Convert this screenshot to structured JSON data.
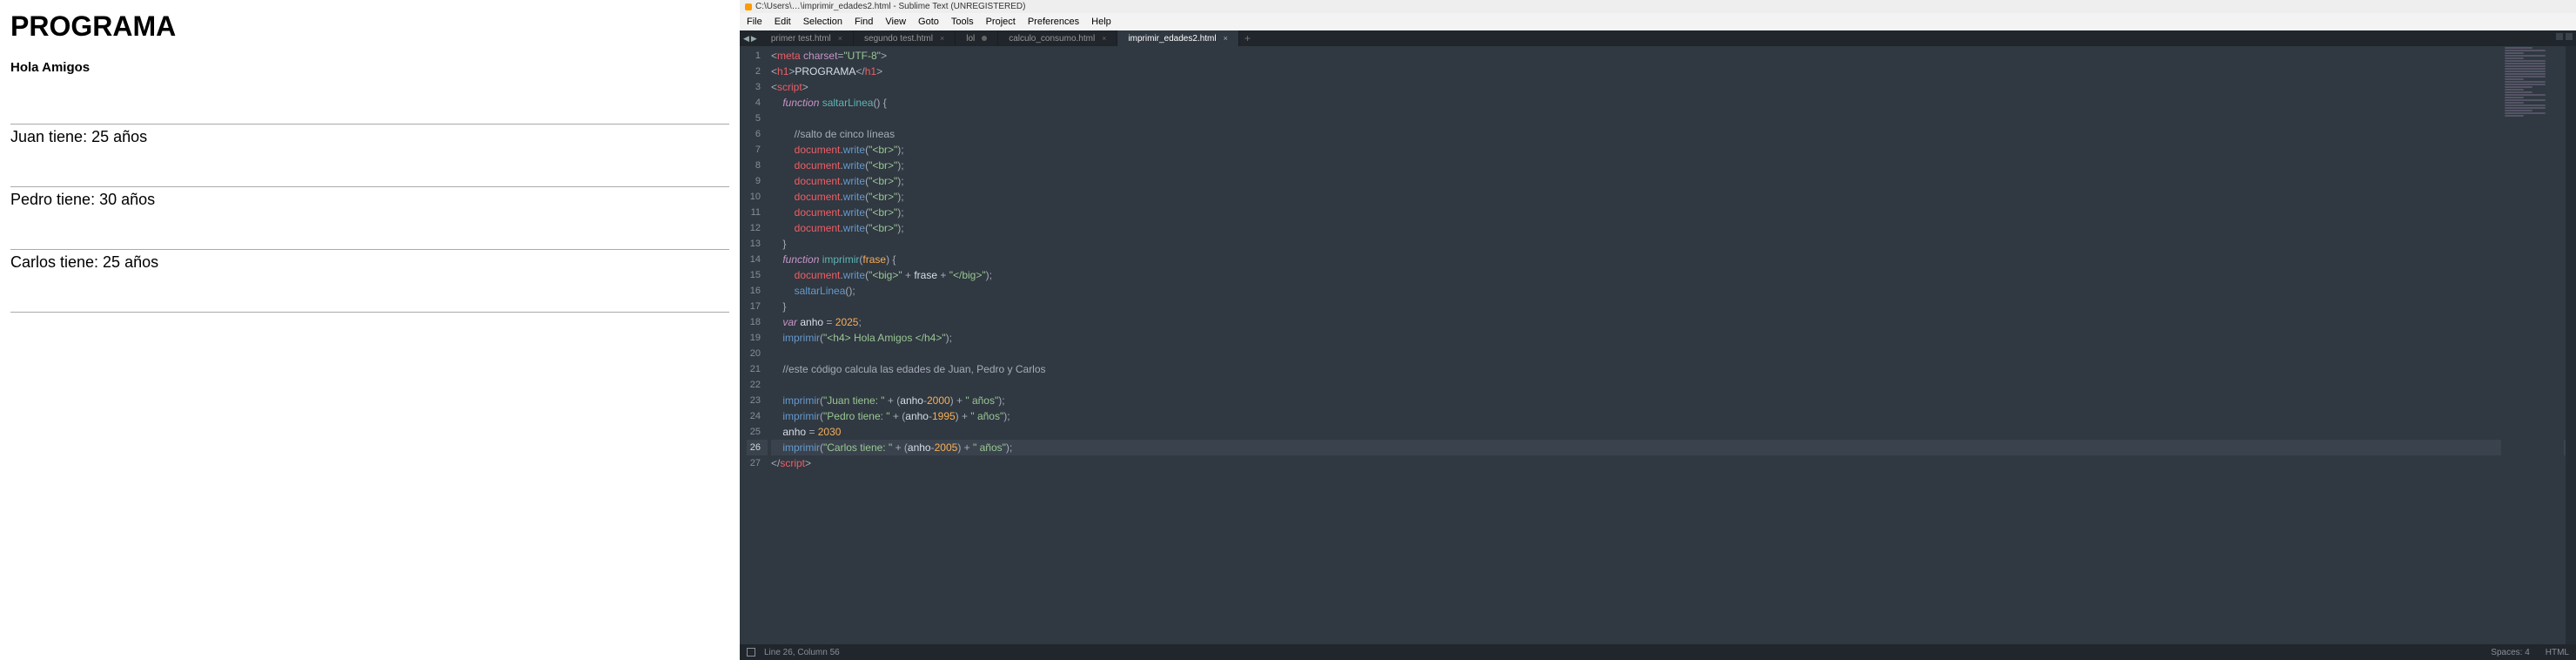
{
  "browser": {
    "title": "PROGRAMA",
    "subtitle": "Hola Amigos",
    "lines": [
      "Juan tiene: 25 años",
      "Pedro tiene: 30 años",
      "Carlos tiene: 25 años"
    ]
  },
  "editor": {
    "window_title": "C:\\Users\\…\\imprimir_edades2.html - Sublime Text (UNREGISTERED)",
    "menu": [
      "File",
      "Edit",
      "Selection",
      "Find",
      "View",
      "Goto",
      "Tools",
      "Project",
      "Preferences",
      "Help"
    ],
    "tabs": [
      {
        "label": "primer test.html",
        "active": false,
        "dirty": false
      },
      {
        "label": "segundo test.html",
        "active": false,
        "dirty": false
      },
      {
        "label": "lol",
        "active": false,
        "dirty": true
      },
      {
        "label": "calculo_consumo.html",
        "active": false,
        "dirty": false
      },
      {
        "label": "imprimir_edades2.html",
        "active": true,
        "dirty": false
      }
    ],
    "status": {
      "cursor": "Line 26, Column 56",
      "spaces": "Spaces: 4",
      "syntax": "HTML"
    },
    "code": [
      {
        "n": 1,
        "html": "<span class='c-pun'>&lt;</span><span class='c-tag'>meta</span> <span class='c-attr'>charset</span><span class='c-pun'>=</span><span class='c-str'>\"UTF-8\"</span><span class='c-pun'>&gt;</span>"
      },
      {
        "n": 2,
        "html": "<span class='c-pun'>&lt;</span><span class='c-tag'>h1</span><span class='c-pun'>&gt;</span><span class='c-txt'>PROGRAMA</span><span class='c-pun'>&lt;/</span><span class='c-tag'>h1</span><span class='c-pun'>&gt;</span>"
      },
      {
        "n": 3,
        "html": "<span class='c-pun'>&lt;</span><span class='c-tag'>script</span><span class='c-pun'>&gt;</span>"
      },
      {
        "n": 4,
        "html": "    <span class='c-kw'>function</span> <span class='c-fn'>saltarLinea</span><span class='c-pun'>() {</span>"
      },
      {
        "n": 5,
        "html": ""
      },
      {
        "n": 6,
        "html": "        <span class='c-cmt'>//salto de cinco líneas</span>"
      },
      {
        "n": 7,
        "html": "        <span class='c-var'>document</span><span class='c-pun'>.</span><span class='c-func'>write</span><span class='c-pun'>(</span><span class='c-str'>\"&lt;br&gt;\"</span><span class='c-pun'>);</span>"
      },
      {
        "n": 8,
        "html": "        <span class='c-var'>document</span><span class='c-pun'>.</span><span class='c-func'>write</span><span class='c-pun'>(</span><span class='c-str'>\"&lt;br&gt;\"</span><span class='c-pun'>);</span>"
      },
      {
        "n": 9,
        "html": "        <span class='c-var'>document</span><span class='c-pun'>.</span><span class='c-func'>write</span><span class='c-pun'>(</span><span class='c-str'>\"&lt;br&gt;\"</span><span class='c-pun'>);</span>"
      },
      {
        "n": 10,
        "html": "        <span class='c-var'>document</span><span class='c-pun'>.</span><span class='c-func'>write</span><span class='c-pun'>(</span><span class='c-str'>\"&lt;br&gt;\"</span><span class='c-pun'>);</span>"
      },
      {
        "n": 11,
        "html": "        <span class='c-var'>document</span><span class='c-pun'>.</span><span class='c-func'>write</span><span class='c-pun'>(</span><span class='c-str'>\"&lt;br&gt;\"</span><span class='c-pun'>);</span>"
      },
      {
        "n": 12,
        "html": "        <span class='c-var'>document</span><span class='c-pun'>.</span><span class='c-func'>write</span><span class='c-pun'>(</span><span class='c-str'>\"&lt;br&gt;\"</span><span class='c-pun'>);</span>"
      },
      {
        "n": 13,
        "html": "    <span class='c-pun'>}</span>"
      },
      {
        "n": 14,
        "html": "    <span class='c-kw'>function</span> <span class='c-fn'>imprimir</span><span class='c-pun'>(</span><span class='c-num'>frase</span><span class='c-pun'>) {</span>"
      },
      {
        "n": 15,
        "html": "        <span class='c-var'>document</span><span class='c-pun'>.</span><span class='c-func'>write</span><span class='c-pun'>(</span><span class='c-str'>\"&lt;big&gt;\"</span> <span class='c-pun'>+</span> <span class='c-txt'>frase</span> <span class='c-pun'>+</span> <span class='c-str'>\"&lt;/big&gt;\"</span><span class='c-pun'>);</span>"
      },
      {
        "n": 16,
        "html": "        <span class='c-func'>saltarLinea</span><span class='c-pun'>();</span>"
      },
      {
        "n": 17,
        "html": "    <span class='c-pun'>}</span>"
      },
      {
        "n": 18,
        "html": "    <span class='c-kw'>var</span> <span class='c-txt'>anho</span> <span class='c-pun'>=</span> <span class='c-num'>2025</span><span class='c-pun'>;</span>"
      },
      {
        "n": 19,
        "html": "    <span class='c-func'>imprimir</span><span class='c-pun'>(</span><span class='c-str'>\"&lt;h4&gt; Hola Amigos &lt;/h4&gt;\"</span><span class='c-pun'>);</span>"
      },
      {
        "n": 20,
        "html": ""
      },
      {
        "n": 21,
        "html": "    <span class='c-cmt'>//este código calcula las edades de Juan, Pedro y Carlos</span>"
      },
      {
        "n": 22,
        "html": ""
      },
      {
        "n": 23,
        "html": "    <span class='c-func'>imprimir</span><span class='c-pun'>(</span><span class='c-str'>\"Juan tiene: \"</span> <span class='c-pun'>+ (</span><span class='c-txt'>anho</span><span class='c-pun'>-</span><span class='c-num'>2000</span><span class='c-pun'>) +</span> <span class='c-str'>\" años\"</span><span class='c-pun'>);</span>"
      },
      {
        "n": 24,
        "html": "    <span class='c-func'>imprimir</span><span class='c-pun'>(</span><span class='c-str'>\"Pedro tiene: \"</span> <span class='c-pun'>+ (</span><span class='c-txt'>anho</span><span class='c-pun'>-</span><span class='c-num'>1995</span><span class='c-pun'>) +</span> <span class='c-str'>\" años\"</span><span class='c-pun'>);</span>"
      },
      {
        "n": 25,
        "html": "    <span class='c-txt'>anho</span> <span class='c-pun'>=</span> <span class='c-num'>2030</span>"
      },
      {
        "n": 26,
        "current": true,
        "html": "    <span class='c-func'>imprimir</span><span class='c-pun'>(</span><span class='c-str'>\"Carlos tiene: \"</span> <span class='c-pun'>+ (</span><span class='c-txt'>anho</span><span class='c-pun'>-</span><span class='c-num'>2005</span><span class='c-pun'>) +</span> <span class='c-str'>\" años\"</span><span class='c-pun'>);</span>"
      },
      {
        "n": 27,
        "html": "<span class='c-pun'>&lt;/</span><span class='c-tag'>script</span><span class='c-pun'>&gt;</span>"
      }
    ]
  }
}
